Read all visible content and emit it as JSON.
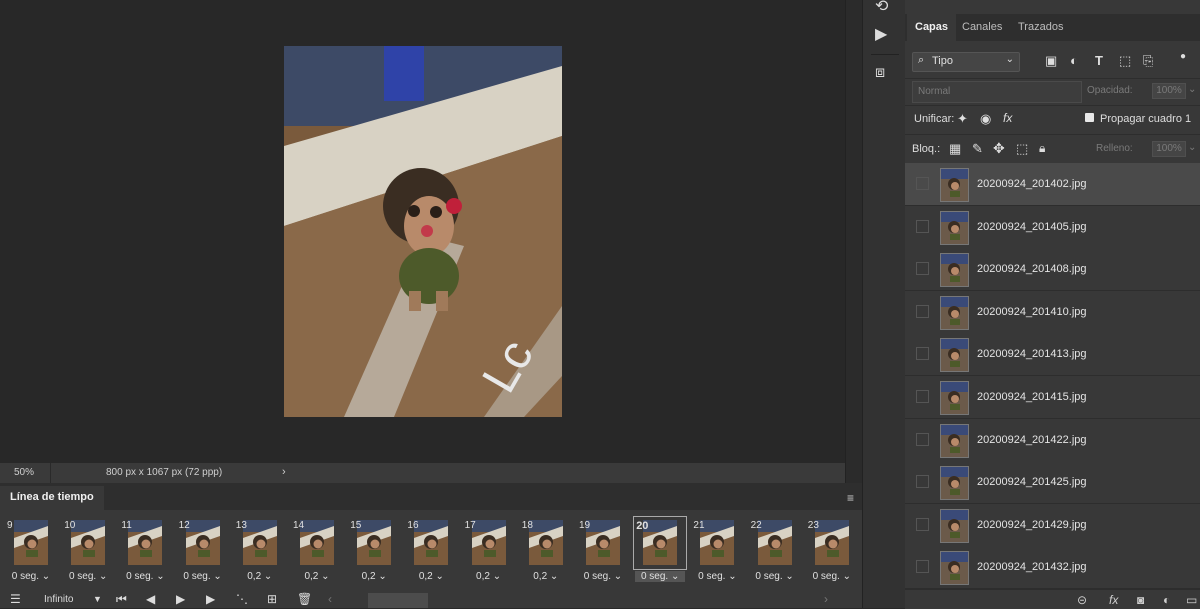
{
  "status_bar": {
    "zoom": "50%",
    "dimensions": "800 px x 1067 px (72 ppp)",
    "arrow": "›"
  },
  "tool_strip": {
    "icons": [
      "history-icon",
      "play-actions-icon",
      "3d-cube-icon"
    ]
  },
  "layers_panel": {
    "tabs": [
      "Capas",
      "Canales",
      "Trazados"
    ],
    "active_tab": "Capas",
    "filter": {
      "selected": "Tipo"
    },
    "blend_mode": "Normal",
    "opacity_label": "Opacidad:",
    "opacity_value": "100%",
    "unify_label": "Unificar:",
    "propagate_label": "Propagar cuadro 1",
    "lock_label": "Bloq.:",
    "fill_label": "Relleno:",
    "fill_value": "100%",
    "layers": [
      "20200924_201402.jpg",
      "20200924_201405.jpg",
      "20200924_201408.jpg",
      "20200924_201410.jpg",
      "20200924_201413.jpg",
      "20200924_201415.jpg",
      "20200924_201422.jpg",
      "20200924_201425.jpg",
      "20200924_201429.jpg",
      "20200924_201432.jpg"
    ],
    "selected_layer_index": 0
  },
  "timeline": {
    "title": "Línea de tiempo",
    "loop_option": "Infinito",
    "frames": [
      {
        "number": "9",
        "delay": "0 seg."
      },
      {
        "number": "10",
        "delay": "0 seg."
      },
      {
        "number": "11",
        "delay": "0 seg."
      },
      {
        "number": "12",
        "delay": "0 seg."
      },
      {
        "number": "13",
        "delay": "0,2"
      },
      {
        "number": "14",
        "delay": "0,2"
      },
      {
        "number": "15",
        "delay": "0,2"
      },
      {
        "number": "16",
        "delay": "0,2"
      },
      {
        "number": "17",
        "delay": "0,2"
      },
      {
        "number": "18",
        "delay": "0,2"
      },
      {
        "number": "19",
        "delay": "0 seg."
      },
      {
        "number": "20",
        "delay": "0 seg."
      },
      {
        "number": "21",
        "delay": "0 seg."
      },
      {
        "number": "22",
        "delay": "0 seg."
      },
      {
        "number": "23",
        "delay": "0 seg."
      }
    ],
    "selected_frame": "20"
  }
}
